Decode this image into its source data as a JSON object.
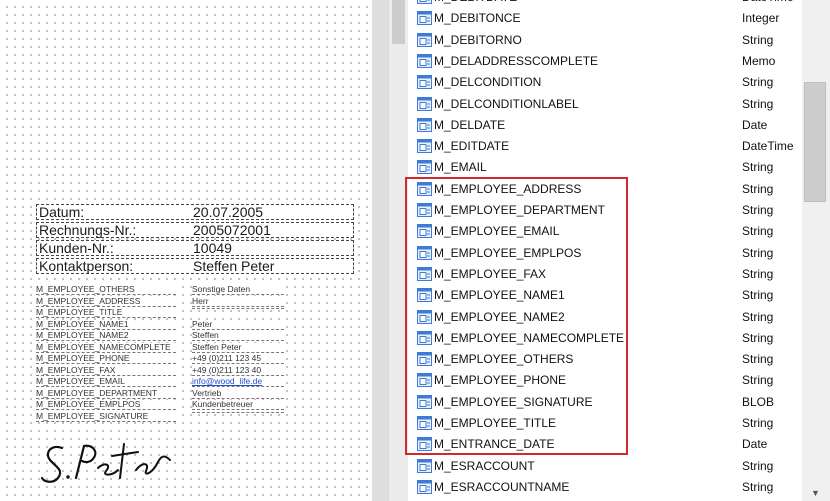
{
  "header_fields": [
    {
      "label": "Datum:",
      "value": "20.07.2005"
    },
    {
      "label": "Rechnungs-Nr.:",
      "value": "2005072001"
    },
    {
      "label": "Kunden-Nr.:",
      "value": "10049"
    },
    {
      "label": "Kontaktperson:",
      "value": "Steffen Peter"
    }
  ],
  "employee_fields": [
    {
      "name": "M_EMPLOYEE_OTHERS",
      "value": "Sonstige Daten"
    },
    {
      "name": "M_EMPLOYEE_ADDRESS",
      "value": "Herr"
    },
    {
      "name": "M_EMPLOYEE_TITLE",
      "value": ""
    },
    {
      "name": "M_EMPLOYEE_NAME1",
      "value": "Peter"
    },
    {
      "name": "M_EMPLOYEE_NAME2",
      "value": "Steffen"
    },
    {
      "name": "M_EMPLOYEE_NAMECOMPLETE",
      "value": "Steffen Peter"
    },
    {
      "name": "M_EMPLOYEE_PHONE",
      "value": "+49 (0)211 123 45"
    },
    {
      "name": "M_EMPLOYEE_FAX",
      "value": "+49 (0)211 123 40"
    },
    {
      "name": "M_EMPLOYEE_EMAIL",
      "value": "info@wood_life.de"
    },
    {
      "name": "M_EMPLOYEE_DEPARTMENT",
      "value": "Vertrieb"
    },
    {
      "name": "M_EMPLOYEE_EMPLPOS",
      "value": "Kundenbetreuer"
    },
    {
      "name": "M_EMPLOYEE_SIGNATURE",
      "value": ""
    }
  ],
  "field_list": [
    {
      "name": "M_DEBITDATE",
      "type": "DateTime"
    },
    {
      "name": "M_DEBITONCE",
      "type": "Integer"
    },
    {
      "name": "M_DEBITORNO",
      "type": "String"
    },
    {
      "name": "M_DELADDRESSCOMPLETE",
      "type": "Memo"
    },
    {
      "name": "M_DELCONDITION",
      "type": "String"
    },
    {
      "name": "M_DELCONDITIONLABEL",
      "type": "String"
    },
    {
      "name": "M_DELDATE",
      "type": "Date"
    },
    {
      "name": "M_EDITDATE",
      "type": "DateTime"
    },
    {
      "name": "M_EMAIL",
      "type": "String"
    },
    {
      "name": "M_EMPLOYEE_ADDRESS",
      "type": "String"
    },
    {
      "name": "M_EMPLOYEE_DEPARTMENT",
      "type": "String"
    },
    {
      "name": "M_EMPLOYEE_EMAIL",
      "type": "String"
    },
    {
      "name": "M_EMPLOYEE_EMPLPOS",
      "type": "String"
    },
    {
      "name": "M_EMPLOYEE_FAX",
      "type": "String"
    },
    {
      "name": "M_EMPLOYEE_NAME1",
      "type": "String"
    },
    {
      "name": "M_EMPLOYEE_NAME2",
      "type": "String"
    },
    {
      "name": "M_EMPLOYEE_NAMECOMPLETE",
      "type": "String"
    },
    {
      "name": "M_EMPLOYEE_OTHERS",
      "type": "String"
    },
    {
      "name": "M_EMPLOYEE_PHONE",
      "type": "String"
    },
    {
      "name": "M_EMPLOYEE_SIGNATURE",
      "type": "BLOB"
    },
    {
      "name": "M_EMPLOYEE_TITLE",
      "type": "String"
    },
    {
      "name": "M_ENTRANCE_DATE",
      "type": "Date"
    },
    {
      "name": "M_ESRACCOUNT",
      "type": "String"
    },
    {
      "name": "M_ESRACCOUNTNAME",
      "type": "String"
    }
  ],
  "icons": {
    "field": "table-field-icon",
    "signature": "signature-image"
  },
  "colors": {
    "highlight": "#d62828",
    "icon_blue": "#3f7ad6",
    "link": "#1f4fcf"
  }
}
